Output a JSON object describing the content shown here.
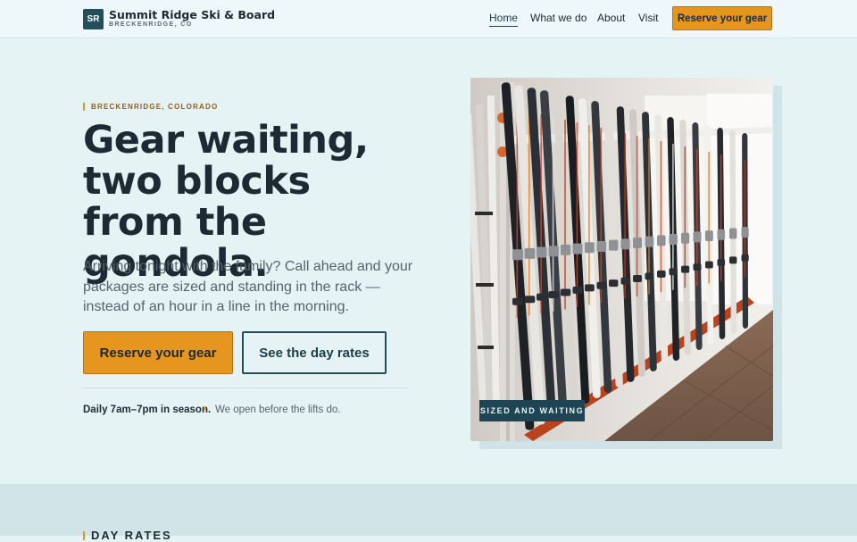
{
  "header": {
    "logo_initials": "SR",
    "brand_name": "Summit Ridge Ski & Board",
    "brand_location": "BRECKENRIDGE, CO",
    "nav": [
      {
        "label": "Home",
        "active": true
      },
      {
        "label": "What we do"
      },
      {
        "label": "About"
      },
      {
        "label": "Visit"
      }
    ],
    "cta_label": "Reserve your gear"
  },
  "hero": {
    "eyebrow": "BRECKENRIDGE, COLORADO",
    "headline": "Gear waiting, two blocks from the gondola.",
    "lede": "Arriving tonight with the family? Call ahead and your packages are sized and standing in the rack — instead of an hour in a line in the morning.",
    "primary_button": "Reserve your gear",
    "secondary_button": "See the day rates",
    "hours": "Daily 7am–7pm in season.",
    "hours_note": "We open before the lifts do.",
    "photo_tag": "SIZED AND WAITING"
  },
  "next_section": {
    "title": "DAY RATES"
  },
  "colors": {
    "accent": "#e6961f",
    "brand_dark": "#244e5c",
    "page_bg": "#e6f3f5",
    "text": "#1c2a33"
  },
  "icons": {
    "logo": "sr-monogram-icon"
  }
}
